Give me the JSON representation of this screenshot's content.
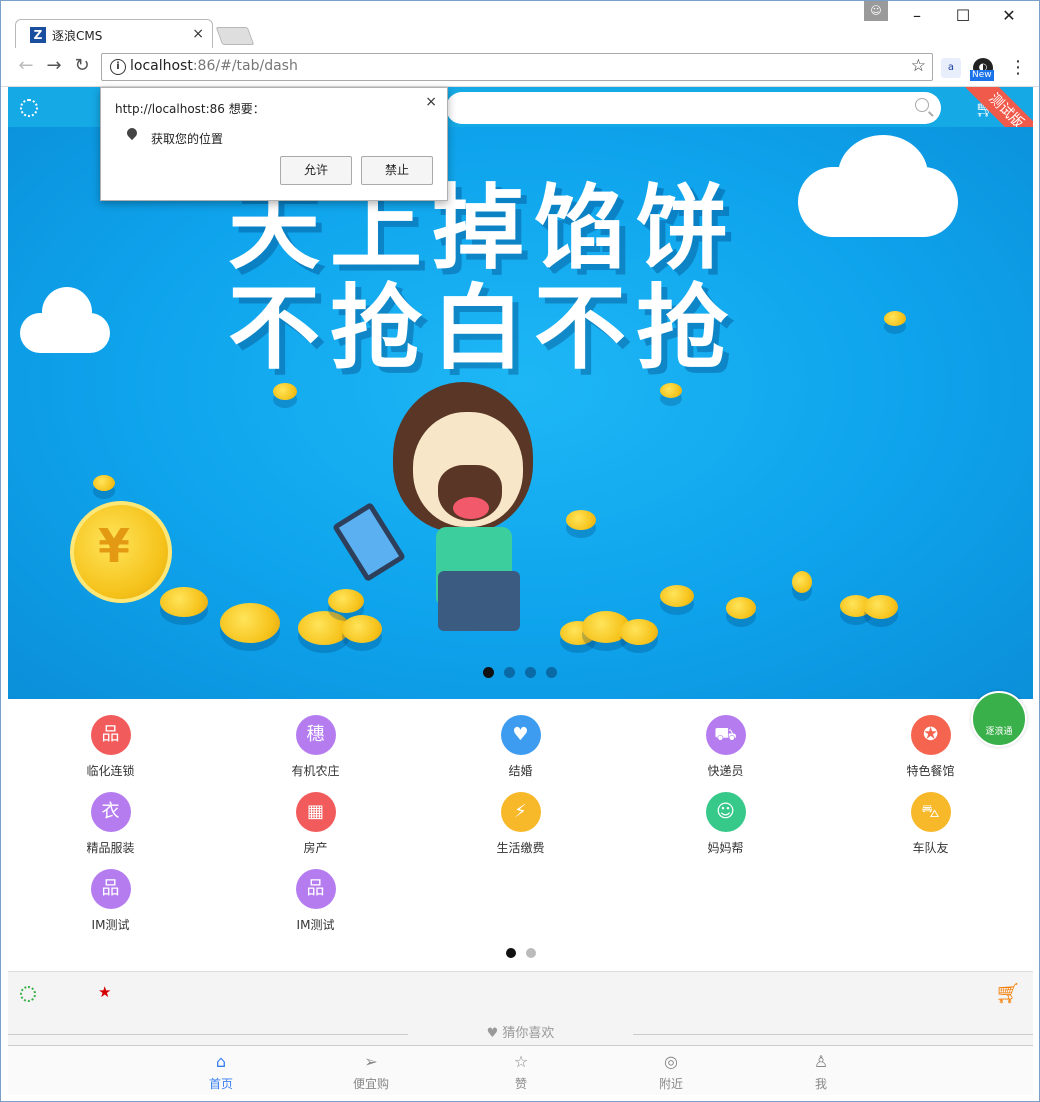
{
  "browser": {
    "tab_title": "逐浪CMS",
    "tab_logo": "Z",
    "close_glyph": "×",
    "url_host": "localhost",
    "url_rest": ":86/#/tab/dash",
    "extension_badge": "New"
  },
  "popup": {
    "title": "http://localhost:86 想要：",
    "message": "获取您的位置",
    "allow": "允许",
    "block": "禁止",
    "close_glyph": "×"
  },
  "app": {
    "ribbon": "测试版",
    "banner_line1": "天上掉馅饼",
    "banner_line2": "不抢白不抢",
    "coin_glyph": "¥",
    "fab_label": "逐浪通",
    "banner_dots": 4,
    "banner_active_dot": 0
  },
  "grid": [
    {
      "label": "临化连锁",
      "color": "#f25b5b",
      "icon": "sitemap-icon",
      "glyph": "品"
    },
    {
      "label": "有机农庄",
      "color": "#b57cf0",
      "icon": "wheat-icon",
      "glyph": "穗"
    },
    {
      "label": "结婚",
      "color": "#3e9cf0",
      "icon": "couple-heart-icon",
      "glyph": "♥"
    },
    {
      "label": "快递员",
      "color": "#b57cf0",
      "icon": "delivery-scooter-icon",
      "glyph": "⛟"
    },
    {
      "label": "特色餐馆",
      "color": "#f5644f",
      "icon": "award-badge-icon",
      "glyph": "✪"
    },
    {
      "label": "精品服装",
      "color": "#b57cf0",
      "icon": "tshirt-icon",
      "glyph": "衣"
    },
    {
      "label": "房产",
      "color": "#f25b5b",
      "icon": "building-icon",
      "glyph": "▦"
    },
    {
      "label": "生活缴费",
      "color": "#f7b82a",
      "icon": "plug-icon",
      "glyph": "⚡"
    },
    {
      "label": "妈妈帮",
      "color": "#36c98a",
      "icon": "mother-baby-icon",
      "glyph": "☺"
    },
    {
      "label": "车队友",
      "color": "#f7b82a",
      "icon": "car-icon",
      "glyph": "⛍"
    },
    {
      "label": "IM测试",
      "color": "#b57cf0",
      "icon": "sitemap-icon",
      "glyph": "品"
    },
    {
      "label": "IM测试",
      "color": "#b57cf0",
      "icon": "sitemap-icon",
      "glyph": "品"
    }
  ],
  "grid_pages": 2,
  "grid_active_page": 0,
  "guess": "猜你喜欢",
  "tabs": [
    {
      "label": "首页",
      "icon": "home-icon",
      "glyph": "⌂"
    },
    {
      "label": "便宜购",
      "icon": "send-icon",
      "glyph": "➢"
    },
    {
      "label": "赞",
      "icon": "star-icon",
      "glyph": "☆"
    },
    {
      "label": "附近",
      "icon": "location-pin-icon",
      "glyph": "◎"
    },
    {
      "label": "我",
      "icon": "user-icon",
      "glyph": "♙"
    }
  ],
  "active_tab": 0,
  "colors": {
    "appbar": "#15a9e6",
    "active_tab": "#3880f0",
    "ribbon": "#f05a4a",
    "cart": "#f57c00"
  }
}
